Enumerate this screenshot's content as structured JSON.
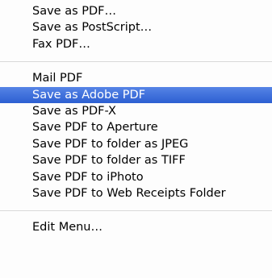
{
  "menu": {
    "group1": [
      {
        "label": "Save as PDF…"
      },
      {
        "label": "Save as PostScript…"
      },
      {
        "label": "Fax PDF…"
      }
    ],
    "group2": [
      {
        "label": "Mail PDF"
      },
      {
        "label": "Save as Adobe PDF",
        "highlighted": true
      },
      {
        "label": "Save as PDF-X"
      },
      {
        "label": "Save PDF to Aperture"
      },
      {
        "label": "Save PDF to folder as JPEG"
      },
      {
        "label": "Save PDF to folder as TIFF"
      },
      {
        "label": "Save PDF to iPhoto"
      },
      {
        "label": "Save PDF to Web Receipts Folder"
      }
    ],
    "group3": [
      {
        "label": "Edit Menu…"
      }
    ]
  },
  "colors": {
    "highlight": "#3f6fd9",
    "highlight_text": "#ffffff",
    "separator": "#d9d9d9"
  }
}
